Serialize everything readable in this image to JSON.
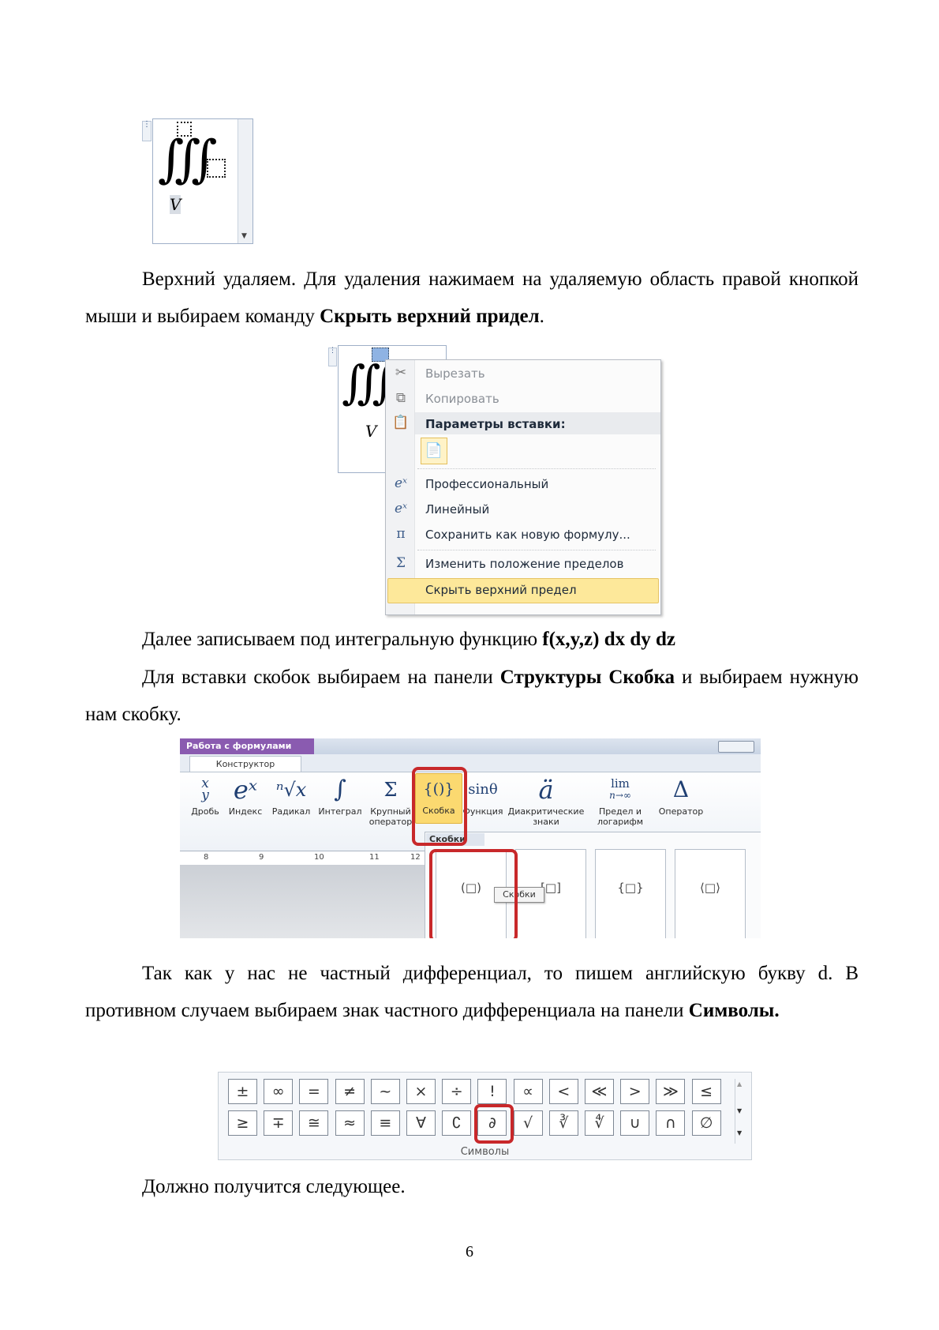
{
  "figure1": {
    "integral": "∭",
    "subscript": "V"
  },
  "paragraph1": {
    "text_a": "Верхний удаляем. Для удаления нажимаем на удаляемую область правой кнопкой мыши и выбираем команду ",
    "bold": "Скрыть верхний придел",
    "text_b": "."
  },
  "figure2": {
    "integral": "∭",
    "subscript": "V",
    "menu_items": [
      {
        "label": "Вырезать",
        "icon": "scissors-icon"
      },
      {
        "label": "Копировать",
        "icon": "copy-icon"
      },
      {
        "label": "Параметры вставки:",
        "icon": "paste-icon"
      },
      {
        "label": "Профессиональный",
        "icon": "professional-format-icon"
      },
      {
        "label": "Линейный",
        "icon": "linear-format-icon"
      },
      {
        "label": "Сохранить как новую формулу...",
        "icon": "save-equation-icon"
      },
      {
        "label": "Изменить положение пределов",
        "icon": "limits-position-icon"
      },
      {
        "label": "Скрыть верхний предел",
        "icon": "hide-limit-icon"
      }
    ]
  },
  "paragraph2": {
    "text": "Далее записываем под интегральную функцию ",
    "bold": "f(x,y,z) dx dy dz"
  },
  "paragraph3": {
    "text_a": "Для вставки скобок выбираем на панели ",
    "bold": "Структуры Скобка",
    "text_b": " и выбираем нужную нам скобку."
  },
  "figure3": {
    "context_tab": "Работа с формулами",
    "tab": "Конструктор",
    "buttons": [
      {
        "glyph": "x/y",
        "label": "Дробь"
      },
      {
        "glyph": "eˣ",
        "label": "Индекс"
      },
      {
        "glyph": "ⁿ√x",
        "label": "Радикал"
      },
      {
        "glyph": "∫",
        "label": "Интеграл"
      },
      {
        "glyph": "Σ",
        "label": "Крупный оператор"
      },
      {
        "glyph": "{()}",
        "label": "Скобка"
      },
      {
        "glyph": "sinθ",
        "label": "Функция"
      },
      {
        "glyph": "ä",
        "label": "Диакритические знаки"
      },
      {
        "glyph": "lim",
        "label": "Предел и логарифм"
      },
      {
        "glyph": "Δ",
        "label": "Оператор"
      }
    ],
    "lim_sub": "n→∞",
    "dropdown_header": "Скобки",
    "tooltip": "Скобки",
    "tiles": [
      "(□)",
      "[□]",
      "{□}",
      "⟨□⟩"
    ],
    "ruler": [
      "8",
      "9",
      "10",
      "11",
      "12"
    ]
  },
  "paragraph4": {
    "text": "Так как у нас не частный дифференциал, то пишем английскую букву d. В противном случаем выбираем знак частного дифференциала на панели ",
    "bold": "Символы."
  },
  "figure4": {
    "row1": [
      "±",
      "∞",
      "=",
      "≠",
      "~",
      "×",
      "÷",
      "!",
      "∝",
      "<",
      "≪",
      ">",
      "≫",
      "≤"
    ],
    "row2": [
      "≥",
      "∓",
      "≅",
      "≈",
      "≡",
      "∀",
      "∁",
      "∂",
      "√",
      "∛",
      "∜",
      "∪",
      "∩",
      "∅"
    ],
    "group_label": "Символы"
  },
  "paragraph5": {
    "text": "Должно получится следующее."
  },
  "page_number": "6"
}
